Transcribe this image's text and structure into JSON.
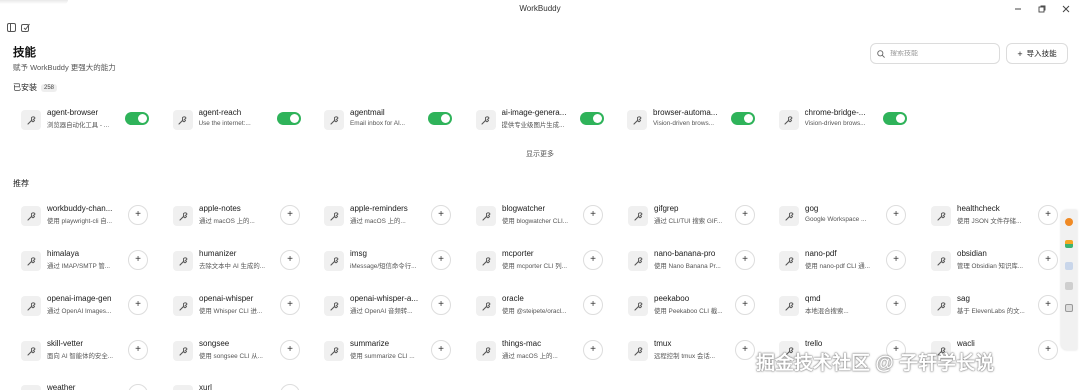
{
  "window": {
    "title": "WorkBuddy"
  },
  "header": {
    "title": "技能",
    "subtitle": "赋予 WorkBuddy 更强大的能力",
    "search_placeholder": "搜索技能",
    "import_label": "导入技能"
  },
  "installed": {
    "label": "已安装",
    "count": "258",
    "show_more": "显示更多",
    "items": [
      {
        "name": "agent-browser",
        "desc": "浏览器自动化工具 - ...",
        "enabled": true
      },
      {
        "name": "agent-reach",
        "desc": "Use the internet:...",
        "enabled": true
      },
      {
        "name": "agentmail",
        "desc": "Email inbox for AI...",
        "enabled": true
      },
      {
        "name": "ai-image-genera...",
        "desc": "提供专业级图片生成...",
        "enabled": true
      },
      {
        "name": "browser-automa...",
        "desc": "Vision-driven brows...",
        "enabled": true
      },
      {
        "name": "chrome-bridge-...",
        "desc": "Vision-driven brows...",
        "enabled": true
      }
    ]
  },
  "recommended": {
    "label": "推荐",
    "items": [
      {
        "name": "workbuddy-chan...",
        "desc": "使用 playwright-cli 自..."
      },
      {
        "name": "apple-notes",
        "desc": "通过 macOS 上的..."
      },
      {
        "name": "apple-reminders",
        "desc": "通过 macOS 上的..."
      },
      {
        "name": "blogwatcher",
        "desc": "使用 blogwatcher CLI..."
      },
      {
        "name": "gifgrep",
        "desc": "通过 CLI/TUI 搜索 GIF..."
      },
      {
        "name": "gog",
        "desc": "Google Workspace ..."
      },
      {
        "name": "healthcheck",
        "desc": "使用 JSON 文件存储..."
      },
      {
        "name": "himalaya",
        "desc": "通过 IMAP/SMTP 管..."
      },
      {
        "name": "humanizer",
        "desc": "去除文本中 AI 生成的..."
      },
      {
        "name": "imsg",
        "desc": "iMessage/短信命令行..."
      },
      {
        "name": "mcporter",
        "desc": "使用 mcporter CLI 列..."
      },
      {
        "name": "nano-banana-pro",
        "desc": "使用 Nano Banana Pr..."
      },
      {
        "name": "nano-pdf",
        "desc": "使用 nano-pdf CLI 通..."
      },
      {
        "name": "obsidian",
        "desc": "管理 Obsidian 知识库..."
      },
      {
        "name": "openai-image-gen",
        "desc": "通过 OpenAI Images..."
      },
      {
        "name": "openai-whisper",
        "desc": "使用 Whisper CLI 进..."
      },
      {
        "name": "openai-whisper-a...",
        "desc": "通过 OpenAI 音频转..."
      },
      {
        "name": "oracle",
        "desc": "使用 @steipete/oracl..."
      },
      {
        "name": "peekaboo",
        "desc": "使用 Peekaboo CLI 截..."
      },
      {
        "name": "qmd",
        "desc": "本地混合搜索..."
      },
      {
        "name": "sag",
        "desc": "基于 ElevenLabs 的文..."
      },
      {
        "name": "skill-vetter",
        "desc": "面向 AI 智能体的安全..."
      },
      {
        "name": "songsee",
        "desc": "使用 songsee CLI 从..."
      },
      {
        "name": "summarize",
        "desc": "使用 summarize CLI ..."
      },
      {
        "name": "things-mac",
        "desc": "通过 macOS 上的..."
      },
      {
        "name": "tmux",
        "desc": "远程控制 tmux 会话..."
      },
      {
        "name": "trello",
        "desc": ""
      },
      {
        "name": "wacli",
        "desc": ""
      },
      {
        "name": "weather",
        "desc": ""
      },
      {
        "name": "xurl",
        "desc": ""
      }
    ]
  },
  "watermark": "掘金技术社区 @ 子轩学长说",
  "colors": {
    "toggle_on": "#2fb35a",
    "accent": "#2fb35a"
  }
}
